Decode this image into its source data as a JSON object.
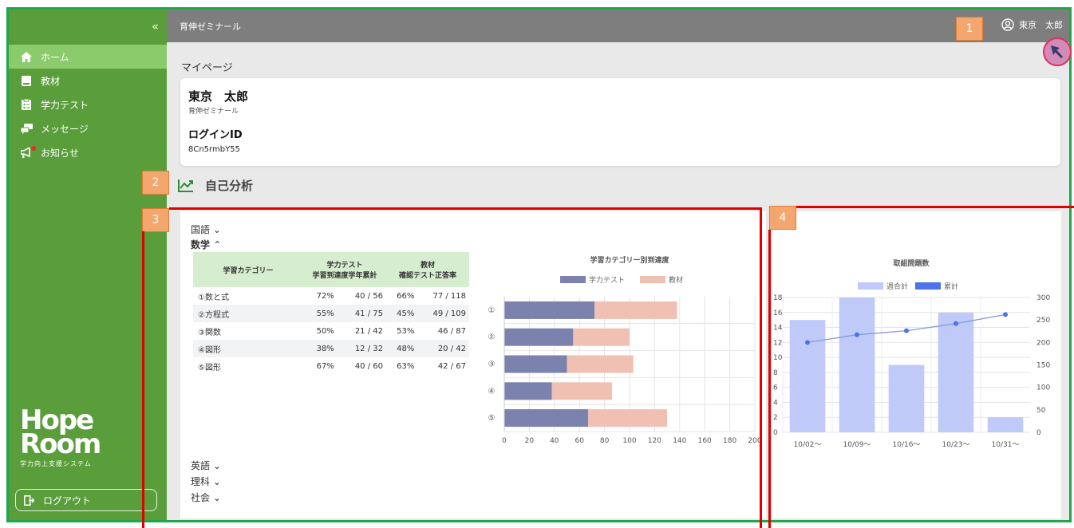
{
  "sidebar": {
    "collapse_label": "«",
    "items": [
      {
        "label": "ホーム",
        "icon": "home-icon",
        "active": true
      },
      {
        "label": "教材",
        "icon": "book-icon",
        "active": false
      },
      {
        "label": "学力テスト",
        "icon": "test-sheet-icon",
        "active": false
      },
      {
        "label": "メッセージ",
        "icon": "chat-icon",
        "active": false
      },
      {
        "label": "お知らせ",
        "icon": "megaphone-icon",
        "active": false
      }
    ],
    "logo_text_1": "Hope",
    "logo_text_2": "Room",
    "logo_tagline": "学力向上支援システム",
    "logout_label": "ログアウト"
  },
  "header": {
    "brand": "育伸ゼミナール",
    "user_name": "東京　太郎"
  },
  "page": {
    "breadcrumb": "マイページ",
    "profile": {
      "name": "東京　太郎",
      "school": "育伸ゼミナール",
      "login_label": "ログインID",
      "login_id": "8Cn5rmbY55"
    },
    "section_title": "自己分析",
    "subjects": {
      "kokugo": "国語",
      "sugaku": "数学",
      "eigo": "英語",
      "rika": "理科",
      "shakai": "社会"
    },
    "table": {
      "headers": [
        "学習カテゴリー",
        "学力テスト\n学習到達度学年累計",
        "教材\n確認テスト正答率"
      ],
      "header_test_1": "学力テスト",
      "header_test_2": "学習到達度学年累計",
      "header_mat_1": "教材",
      "header_mat_2": "確認テスト正答率",
      "rows": [
        {
          "category": "①数と式",
          "test_pct": "72%",
          "test_count": "40 / 56",
          "mat_pct": "66%",
          "mat_count": "77 / 118"
        },
        {
          "category": "②方程式",
          "test_pct": "55%",
          "test_count": "41 / 75",
          "mat_pct": "45%",
          "mat_count": "49 / 109"
        },
        {
          "category": "③関数",
          "test_pct": "50%",
          "test_count": "21 / 42",
          "mat_pct": "53%",
          "mat_count": "46 / 87"
        },
        {
          "category": "④図形",
          "test_pct": "38%",
          "test_count": "12 / 32",
          "mat_pct": "48%",
          "mat_count": "20 / 42"
        },
        {
          "category": "⑤図形",
          "test_pct": "67%",
          "test_count": "40 / 60",
          "mat_pct": "63%",
          "mat_count": "42 / 67"
        }
      ]
    },
    "annotations": [
      "1",
      "2",
      "3",
      "4"
    ]
  },
  "chart_data": [
    {
      "type": "bar",
      "orientation": "horizontal",
      "stacked": true,
      "title": "学習カテゴリー別到達度",
      "categories": [
        "①",
        "②",
        "③",
        "④",
        "⑤"
      ],
      "series": [
        {
          "name": "学力テスト",
          "values": [
            72,
            55,
            50,
            38,
            67
          ],
          "color": "#7a82ad"
        },
        {
          "name": "教材",
          "values": [
            66,
            45,
            53,
            48,
            63
          ],
          "color": "#f0c1b3"
        }
      ],
      "xlim": [
        0,
        200
      ],
      "xticks": [
        0,
        20,
        40,
        60,
        80,
        100,
        120,
        140,
        160,
        180,
        200
      ],
      "legend": "top",
      "grid": true
    },
    {
      "type": "bar",
      "title": "取組問題数",
      "categories": [
        "10/02～",
        "10/09～",
        "10/16～",
        "10/23～",
        "10/31～"
      ],
      "series": [
        {
          "name": "週合計",
          "type": "bar",
          "axis": "left",
          "values": [
            15,
            18,
            9,
            16,
            2
          ],
          "color": "#bfcaf9"
        },
        {
          "name": "累計",
          "type": "line",
          "axis": "right",
          "values": [
            200,
            217,
            226,
            242,
            262
          ],
          "color": "#4a74e8"
        }
      ],
      "ylim_left": [
        0,
        18
      ],
      "yticks_left": [
        0,
        2,
        4,
        6,
        8,
        10,
        12,
        14,
        16,
        18
      ],
      "ylim_right": [
        0,
        300
      ],
      "yticks_right": [
        0,
        50,
        100,
        150,
        200,
        250,
        300
      ],
      "legend": "top",
      "grid": true
    }
  ]
}
